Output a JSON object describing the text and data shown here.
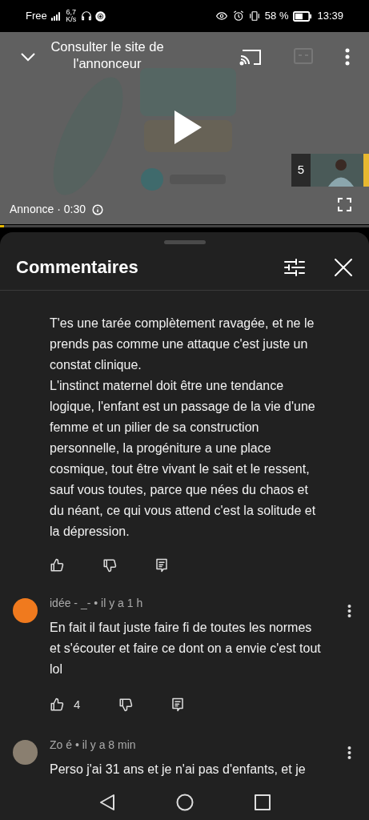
{
  "status_bar": {
    "carrier": "Free",
    "speed": "6,7 K/s",
    "battery": "58 %",
    "time": "13:39"
  },
  "player": {
    "advertiser_link": "Consulter le site de l'annonceur",
    "ad_label": "Annonce · 0:30",
    "queue_count": "5",
    "level": 0.01
  },
  "comments_panel": {
    "title": "Commentaires"
  },
  "comments": [
    {
      "text": "T'es une tarée complètement ravagée, et ne le prends pas comme une attaque c'est juste un constat clinique.\nL'instinct maternel doit être une tendance logique, l'enfant est un passage de la vie d'une femme et un pilier de sa construction personnelle, la progéniture a une place cosmique, tout être vivant le sait et le ressent, sauf vous toutes, parce que nées du chaos et du néant, ce qui vous attend c'est la solitude et la dépression.",
      "show_actions": true
    },
    {
      "meta": "idée - _- • il y a 1 h",
      "color": "#f07a1e",
      "text": "En fait il faut juste faire fi de toutes les normes et s'écouter et faire ce dont on a envie c'est tout lol",
      "likes": "4",
      "show_actions": true
    },
    {
      "meta": "Zo é • il y a 8 min",
      "color": "#8a7f70",
      "text": "Perso j'ai 31 ans et je n'ai pas d'enfants, et je",
      "show_actions": false
    }
  ]
}
